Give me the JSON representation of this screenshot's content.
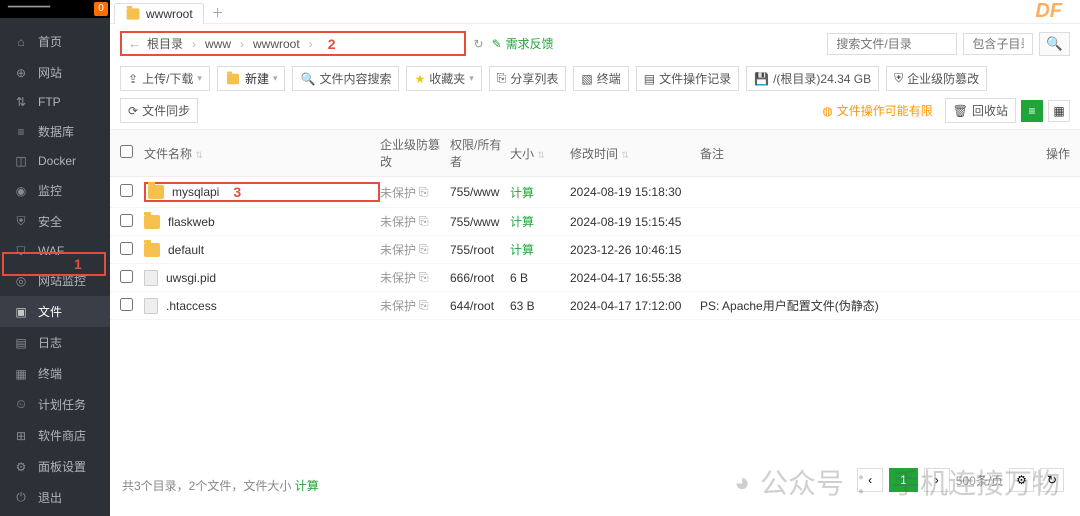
{
  "sidebar": {
    "header_text": "━━━━━━━",
    "badge": "0",
    "items": [
      {
        "label": "首页",
        "icon": "home"
      },
      {
        "label": "网站",
        "icon": "globe"
      },
      {
        "label": "FTP",
        "icon": "ftp"
      },
      {
        "label": "数据库",
        "icon": "db"
      },
      {
        "label": "Docker",
        "icon": "docker"
      },
      {
        "label": "监控",
        "icon": "monitor"
      },
      {
        "label": "安全",
        "icon": "shield"
      },
      {
        "label": "WAF",
        "icon": "waf"
      },
      {
        "label": "网站监控",
        "icon": "watch"
      },
      {
        "label": "文件",
        "icon": "folder",
        "active": true
      },
      {
        "label": "日志",
        "icon": "log"
      },
      {
        "label": "终端",
        "icon": "terminal"
      },
      {
        "label": "计划任务",
        "icon": "cron"
      },
      {
        "label": "软件商店",
        "icon": "store"
      },
      {
        "label": "面板设置",
        "icon": "settings"
      },
      {
        "label": "退出",
        "icon": "exit"
      }
    ]
  },
  "tab": {
    "label": "wwwroot"
  },
  "breadcrumb": {
    "root": "根目录",
    "a": "www",
    "b": "wwwroot"
  },
  "pathbar": {
    "feedback": "需求反馈",
    "search_ph": "搜索文件/目录",
    "include_sub_ph": "包含子目录"
  },
  "toolbar": {
    "upload": "上传/下载",
    "new": "新建",
    "search_content": "文件内容搜索",
    "favorites": "收藏夹",
    "share_list": "分享列表",
    "terminal": "终端",
    "ops_record": "文件操作记录",
    "disk_usage": "/(根目录)24.34 GB",
    "tamper": "企业级防篡改",
    "filesync": "文件同步",
    "tamper_warn": "文件操作可能有限",
    "trash": "回收站"
  },
  "columns": {
    "name": "文件名称",
    "tamper": "企业级防篡改",
    "perm": "权限/所有者",
    "size": "大小",
    "mtime": "修改时间",
    "note": "备注",
    "action": "操作"
  },
  "rows": [
    {
      "name": "mysqlapi",
      "type": "folder",
      "prot": "未保护",
      "perm": "755/www",
      "size": "计算",
      "mtime": "2024-08-19 15:18:30",
      "note": "",
      "highlight": true
    },
    {
      "name": "flaskweb",
      "type": "folder",
      "prot": "未保护",
      "perm": "755/www",
      "size": "计算",
      "mtime": "2024-08-19 15:15:45",
      "note": ""
    },
    {
      "name": "default",
      "type": "folder",
      "prot": "未保护",
      "perm": "755/root",
      "size": "计算",
      "mtime": "2023-12-26 10:46:15",
      "note": ""
    },
    {
      "name": "uwsgi.pid",
      "type": "file",
      "prot": "未保护",
      "perm": "666/root",
      "size": "6 B",
      "mtime": "2024-04-17 16:55:38",
      "note": ""
    },
    {
      "name": ".htaccess",
      "type": "file",
      "prot": "未保护",
      "perm": "644/root",
      "size": "63 B",
      "mtime": "2024-04-17 17:12:00",
      "note": "PS: Apache用户配置文件(伪静态)"
    }
  ],
  "footer": {
    "summary": "共3个目录，2个文件，文件大小",
    "compute": "计算",
    "page_size": "500",
    "per_page_suffix": "条/页",
    "page": "1"
  },
  "annotations": {
    "sidebar": "1",
    "breadcrumb": "2",
    "row": "3"
  },
  "watermark": {
    "top": "DF",
    "bottom_prefix": "公众号",
    "bottom_colon": "：",
    "bottom_text": "手机连接万物"
  }
}
